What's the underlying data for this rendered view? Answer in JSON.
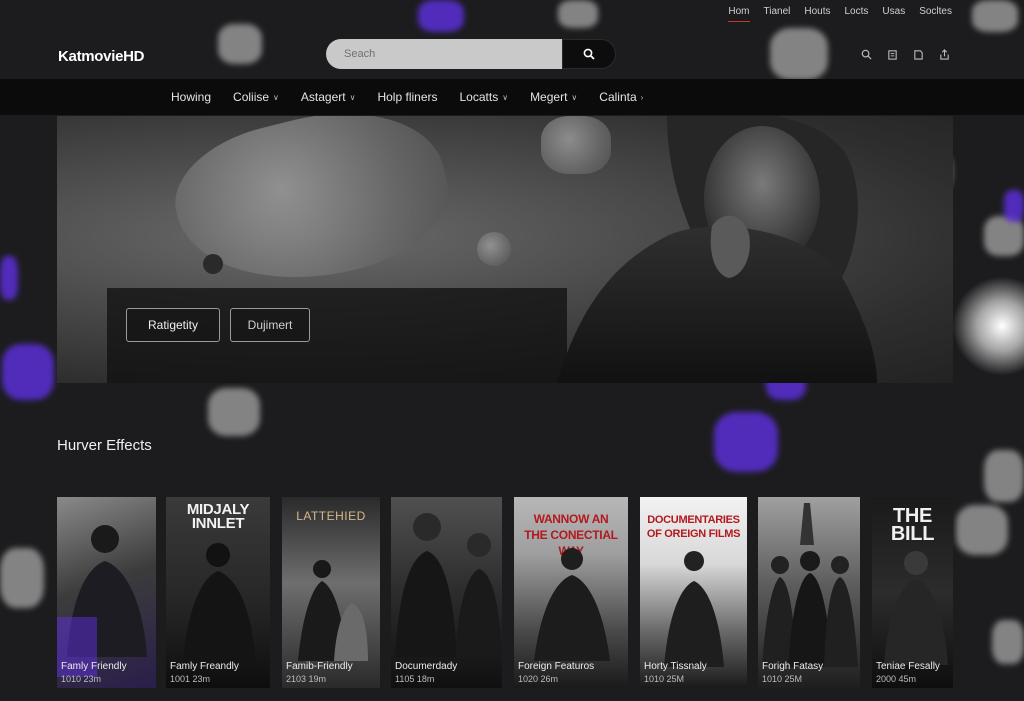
{
  "utility_nav": [
    "Hom",
    "Tianel",
    "Houts",
    "Locts",
    "Usas",
    "Socltes"
  ],
  "brand": {
    "logo": "KatmovieHD"
  },
  "search": {
    "placeholder": "Seach"
  },
  "header_icons": [
    "search-icon",
    "clipboard-icon",
    "document-icon",
    "share-icon"
  ],
  "nav": [
    {
      "label": "Howing",
      "dropdown": false
    },
    {
      "label": "Coliise",
      "dropdown": true
    },
    {
      "label": "Astagert",
      "dropdown": true
    },
    {
      "label": "Holp fliners",
      "dropdown": false
    },
    {
      "label": "Locatts",
      "dropdown": true
    },
    {
      "label": "Megert",
      "dropdown": true
    },
    {
      "label": "Calinta",
      "dropdown": true
    }
  ],
  "hero": {
    "buttons": [
      "Ratigetity",
      "Dujimert"
    ]
  },
  "section": {
    "title": "Hurver Effects"
  },
  "posters": [
    {
      "title": "",
      "label": "Famly Friendly",
      "meta": "1010 23m"
    },
    {
      "title": "MIDJALY\nINNLET",
      "label": "Famly Freandly",
      "meta": "1001 23m"
    },
    {
      "title": "LATTEHIED",
      "label": "Famib-Friendly",
      "meta": "2103 19m"
    },
    {
      "title": "",
      "label": "Documerdady",
      "meta": "1105 18m"
    },
    {
      "title": "WANNOW AN\nTHE CONECTIAL WAY",
      "label": "Foreign Featuros",
      "meta": "1020 26m"
    },
    {
      "title": "DOCUMENTARIES\nOF OREIGN FILMS",
      "label": "Horty Tissnaly",
      "meta": "1010 25M"
    },
    {
      "title": "",
      "label": "Forigh Fatasy",
      "meta": "1010 25M"
    },
    {
      "title": "THE\nBILL",
      "label": "Teniae Fesally",
      "meta": "2000 45m"
    }
  ],
  "colors": {
    "background": "#1c1c1e",
    "navbar": "#0b0b0b",
    "accent_purple": "#5b2fd6",
    "poster_red": "#b3191e",
    "active_underline": "#c0392b"
  }
}
